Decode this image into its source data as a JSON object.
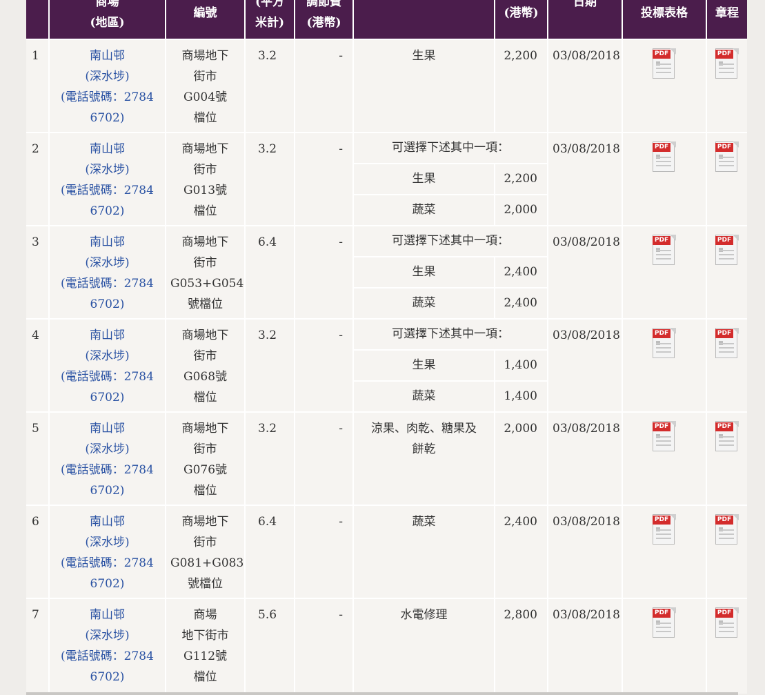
{
  "header": {
    "col_market": [
      "商場",
      "(地區)"
    ],
    "col_code": "編號",
    "col_area": [
      "(平方",
      "米計)"
    ],
    "col_fee": [
      "調節費",
      "(港幣)"
    ],
    "col_rent": "(港幣)",
    "col_date": "日期",
    "col_form": "投標表格",
    "col_rules": "章程"
  },
  "rows": [
    {
      "no": "1",
      "market": [
        "南山邨",
        "(深水埗)",
        "(電話號碼：2784",
        "6702)"
      ],
      "code": [
        "商場地下",
        "街市",
        "G004號",
        "檔位"
      ],
      "area": "3.2",
      "fee": "-",
      "trade": "生果",
      "rent": "2,200",
      "date": "03/08/2018"
    },
    {
      "no": "2",
      "market": [
        "南山邨",
        "(深水埗)",
        "(電話號碼：2784",
        "6702)"
      ],
      "code": [
        "商場地下",
        "街市",
        "G013號",
        "檔位"
      ],
      "area": "3.2",
      "fee": "-",
      "choose": "可選擇下述其中一項：",
      "options": [
        {
          "trade": "生果",
          "rent": "2,200"
        },
        {
          "trade": "蔬菜",
          "rent": "2,000"
        }
      ],
      "date": "03/08/2018"
    },
    {
      "no": "3",
      "market": [
        "南山邨",
        "(深水埗)",
        "(電話號碼：2784",
        "6702)"
      ],
      "code": [
        "商場地下",
        "街市",
        "G053+G054",
        "號檔位"
      ],
      "area": "6.4",
      "fee": "-",
      "choose": "可選擇下述其中一項：",
      "options": [
        {
          "trade": "生果",
          "rent": "2,400"
        },
        {
          "trade": "蔬菜",
          "rent": "2,400"
        }
      ],
      "date": "03/08/2018"
    },
    {
      "no": "4",
      "market": [
        "南山邨",
        "(深水埗)",
        "(電話號碼：2784",
        "6702)"
      ],
      "code": [
        "商場地下",
        "街市",
        "G068號",
        "檔位"
      ],
      "area": "3.2",
      "fee": "-",
      "choose": "可選擇下述其中一項：",
      "options": [
        {
          "trade": "生果",
          "rent": "1,400"
        },
        {
          "trade": "蔬菜",
          "rent": "1,400"
        }
      ],
      "date": "03/08/2018"
    },
    {
      "no": "5",
      "market": [
        "南山邨",
        "(深水埗)",
        "(電話號碼：2784",
        "6702)"
      ],
      "code": [
        "商場地下",
        "街市",
        "G076號",
        "檔位"
      ],
      "area": "3.2",
      "fee": "-",
      "trade_lines": [
        "涼果、肉乾、糖果及",
        "餅乾"
      ],
      "rent": "2,000",
      "date": "03/08/2018"
    },
    {
      "no": "6",
      "market": [
        "南山邨",
        "(深水埗)",
        "(電話號碼：2784",
        "6702)"
      ],
      "code": [
        "商場地下",
        "街市",
        "G081+G083",
        "號檔位"
      ],
      "area": "6.4",
      "fee": "-",
      "trade": "蔬菜",
      "rent": "2,400",
      "date": "03/08/2018"
    },
    {
      "no": "7",
      "market": [
        "南山邨",
        "(深水埗)",
        "(電話號碼：2784",
        "6702)"
      ],
      "code": [
        "商場",
        "地下街市",
        "G112號",
        "檔位"
      ],
      "area": "5.6",
      "fee": "-",
      "trade": "水電修理",
      "rent": "2,800",
      "date": "03/08/2018"
    }
  ],
  "pdf_icon_label": "PDF",
  "colors": {
    "header_bg": "#4b1d4c",
    "cell_bg": "#f6f4f1",
    "link": "#2a52a3",
    "pdf_red": "#d32c2c"
  }
}
